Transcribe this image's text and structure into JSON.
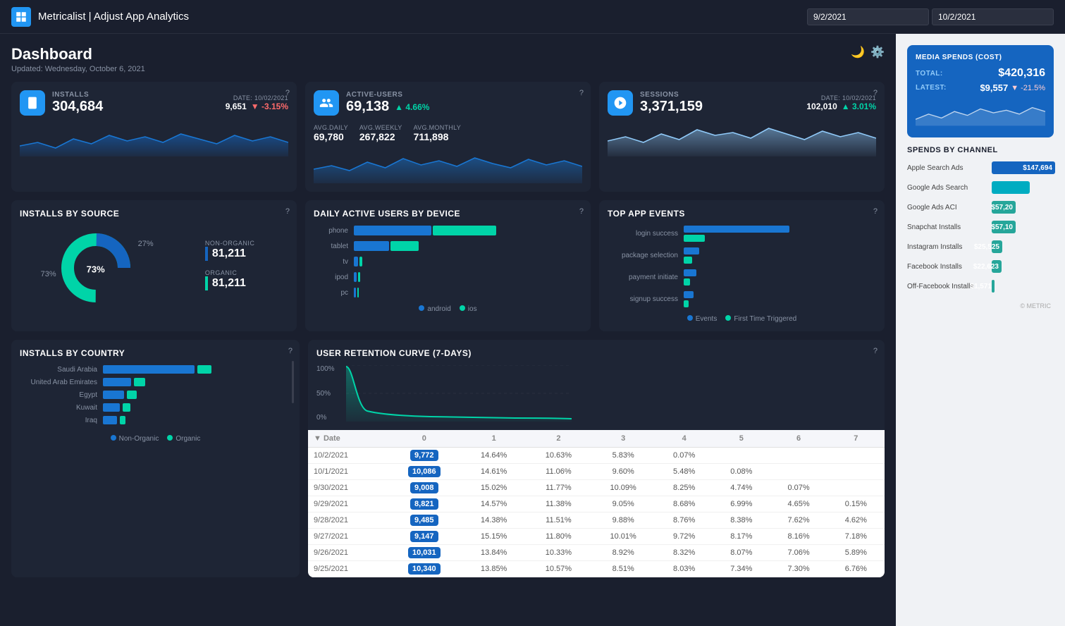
{
  "header": {
    "logo_alt": "Metricalist logo",
    "title": "Metricalist | Adjust App Analytics",
    "date_start": "9/2/2021",
    "date_end": "10/2/2021"
  },
  "dashboard": {
    "title": "Dashboard",
    "updated": "Updated: Wednesday, October 6, 2021"
  },
  "metric_cards": [
    {
      "id": "installs",
      "icon": "mobile",
      "label": "INSTALLS",
      "value": "304,684",
      "date_label": "DATE: 10/02/2021",
      "date_value": "9,651",
      "change": "▼ -3.15%",
      "change_type": "neg"
    },
    {
      "id": "active_users",
      "icon": "users",
      "label": "ACTIVE-USERS",
      "value": "69,138",
      "change": "▲ 4.66%",
      "change_type": "pos",
      "avg_daily_label": "AVG.DAILY",
      "avg_daily": "69,780",
      "avg_weekly_label": "AVG.WEEKLY",
      "avg_weekly": "267,822",
      "avg_monthly_label": "AVG.MONTHLY",
      "avg_monthly": "711,898"
    },
    {
      "id": "sessions",
      "icon": "clock",
      "label": "SESSIONS",
      "value": "3,371,159",
      "date_label": "DATE: 10/02/2021",
      "date_value": "102,010",
      "change": "▲ 3.01%",
      "change_type": "pos"
    }
  ],
  "media_spends": {
    "title": "MEDIA SPENDS (COST)",
    "total_label": "TOTAL:",
    "total_value": "$420,316",
    "latest_label": "LATEST:",
    "latest_value": "$9,557",
    "latest_change": "▼ -21.5%"
  },
  "installs_by_source": {
    "title": "INSTALLS BY SOURCE",
    "non_organic_label": "NON-ORGANIC",
    "non_organic_pct": "27%",
    "non_organic_val": "81,211",
    "organic_label": "ORGANIC",
    "organic_pct": "73%",
    "organic_val": "81,211"
  },
  "daily_active_users": {
    "title": "DAILY ACTIVE USERS BY DEVICE",
    "devices": [
      "phone",
      "tablet",
      "tv",
      "ipod",
      "pc"
    ],
    "android_bars": [
      100,
      45,
      5,
      3,
      2
    ],
    "ios_bars": [
      85,
      35,
      3,
      2,
      1
    ],
    "legend": [
      "android",
      "ios"
    ]
  },
  "top_app_events": {
    "title": "TOP APP EVENTS",
    "events": [
      {
        "label": "login success",
        "events_bar": 95,
        "ftt_bar": 20
      },
      {
        "label": "package selection",
        "events_bar": 15,
        "ftt_bar": 8
      },
      {
        "label": "payment initiate",
        "events_bar": 12,
        "ftt_bar": 6
      },
      {
        "label": "signup success",
        "events_bar": 10,
        "ftt_bar": 5
      }
    ],
    "legend_events": "Events",
    "legend_ftt": "First Time Triggered"
  },
  "spends_by_channel": {
    "title": "SPENDS BY CHANNEL",
    "channels": [
      {
        "name": "Apple Search Ads",
        "value": "$147,694",
        "bar_pct": 100,
        "color": "#1565c0"
      },
      {
        "name": "Google Ads Search",
        "value": "",
        "bar_pct": 60,
        "color": "#00acc1"
      },
      {
        "name": "Google Ads ACI",
        "value": "$57,20",
        "bar_pct": 38,
        "color": "#26a69a"
      },
      {
        "name": "Snapchat Installs",
        "value": "$57,10",
        "bar_pct": 38,
        "color": "#26a69a"
      },
      {
        "name": "Instagram Installs",
        "value": "$25,525",
        "bar_pct": 17,
        "color": "#26a69a"
      },
      {
        "name": "Facebook Installs",
        "value": "$22,623",
        "bar_pct": 15,
        "color": "#26a69a"
      },
      {
        "name": "Off-Facebook Installs",
        "value": "$1,571",
        "bar_pct": 2,
        "color": "#26a69a"
      }
    ]
  },
  "installs_by_country": {
    "title": "INSTALLS BY COUNTRY",
    "countries": [
      {
        "name": "Saudi Arabia",
        "non_organic": 85,
        "organic": 15
      },
      {
        "name": "United Arab Emirates",
        "non_organic": 30,
        "organic": 12
      },
      {
        "name": "Egypt",
        "non_organic": 22,
        "organic": 10
      },
      {
        "name": "Kuwait",
        "non_organic": 18,
        "organic": 8
      },
      {
        "name": "Iraq",
        "non_organic": 15,
        "organic": 6
      }
    ],
    "legend": [
      "Non-Organic",
      "Organic"
    ]
  },
  "retention_curve": {
    "title": "USER RETENTION CURVE (7-DAYS)",
    "pct_labels": [
      "100%",
      "50%",
      "0%"
    ]
  },
  "retention_table": {
    "headers": [
      "Date",
      "0",
      "1",
      "2",
      "3",
      "4",
      "5",
      "6",
      "7"
    ],
    "rows": [
      {
        "date": "10/2/2021",
        "d0": "9,772",
        "d1": "14.64%",
        "d2": "10.63%",
        "d3": "5.83%",
        "d4": "0.07%",
        "d5": "",
        "d6": "",
        "d7": ""
      },
      {
        "date": "10/1/2021",
        "d0": "10,086",
        "d1": "14.61%",
        "d2": "11.06%",
        "d3": "9.60%",
        "d4": "5.48%",
        "d5": "0.08%",
        "d6": "",
        "d7": ""
      },
      {
        "date": "9/30/2021",
        "d0": "9,008",
        "d1": "15.02%",
        "d2": "11.77%",
        "d3": "10.09%",
        "d4": "8.25%",
        "d5": "4.74%",
        "d6": "0.07%",
        "d7": ""
      },
      {
        "date": "9/29/2021",
        "d0": "8,821",
        "d1": "14.57%",
        "d2": "11.38%",
        "d3": "9.05%",
        "d4": "8.68%",
        "d5": "6.99%",
        "d6": "4.65%",
        "d7": "0.15%"
      },
      {
        "date": "9/28/2021",
        "d0": "9,485",
        "d1": "14.38%",
        "d2": "11.51%",
        "d3": "9.88%",
        "d4": "8.76%",
        "d5": "8.38%",
        "d6": "7.62%",
        "d7": "4.62%"
      },
      {
        "date": "9/27/2021",
        "d0": "9,147",
        "d1": "15.15%",
        "d2": "11.80%",
        "d3": "10.01%",
        "d4": "9.72%",
        "d5": "8.17%",
        "d6": "8.16%",
        "d7": "7.18%"
      },
      {
        "date": "9/26/2021",
        "d0": "10,031",
        "d1": "13.84%",
        "d2": "10.33%",
        "d3": "8.92%",
        "d4": "8.32%",
        "d5": "8.07%",
        "d6": "7.06%",
        "d7": "5.89%"
      },
      {
        "date": "9/25/2021",
        "d0": "10,340",
        "d1": "13.85%",
        "d2": "10.57%",
        "d3": "8.51%",
        "d4": "8.03%",
        "d5": "7.34%",
        "d6": "7.30%",
        "d7": "6.76%"
      }
    ]
  },
  "watermark": "© METRIC"
}
